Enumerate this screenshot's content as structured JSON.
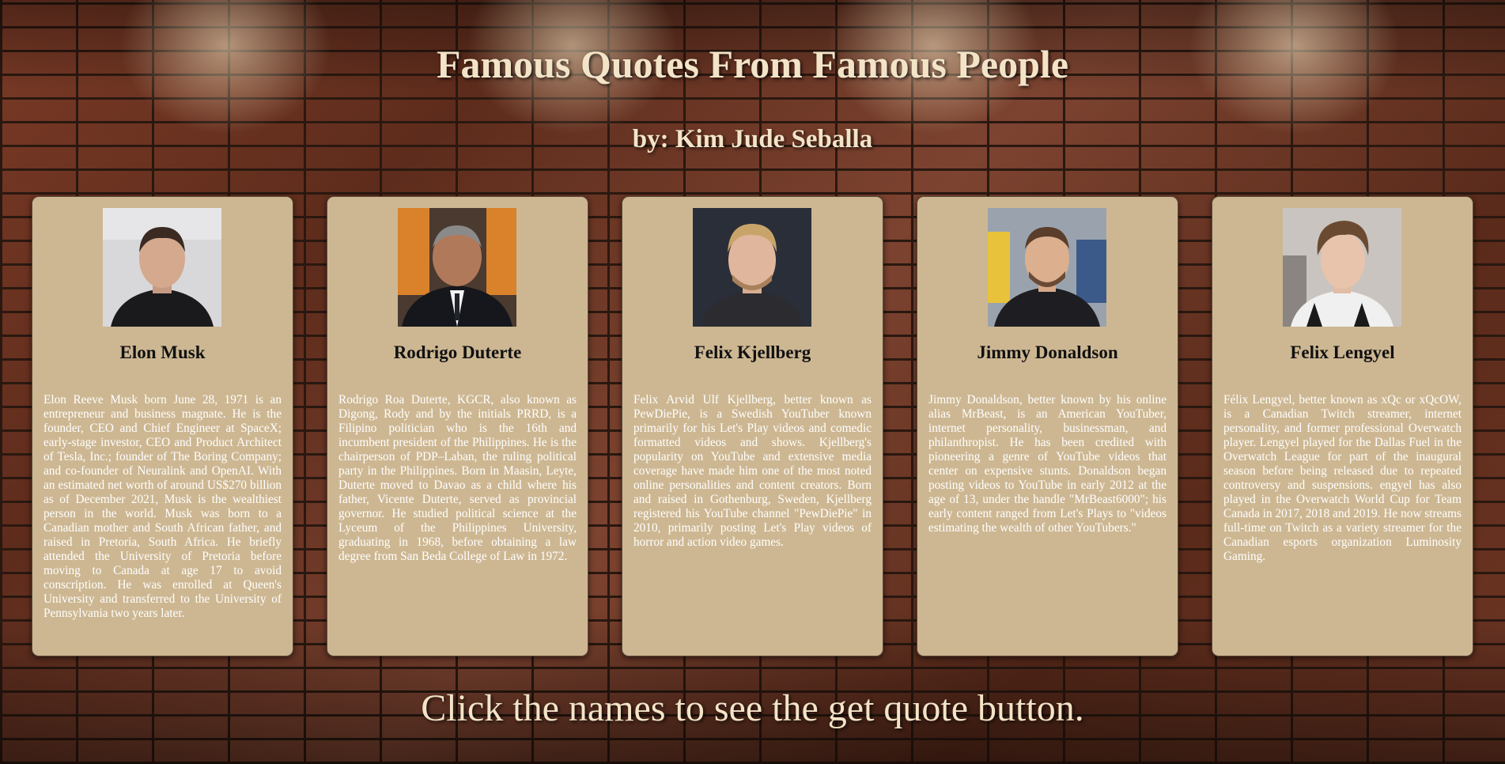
{
  "header": {
    "title": "Famous Quotes From Famous People",
    "subtitle": "by: Kim Jude Seballa"
  },
  "cards": [
    {
      "name": "Elon Musk",
      "bio": "Elon Reeve Musk born June 28, 1971 is an entrepreneur and business magnate. He is the founder, CEO and Chief Engineer at SpaceX; early-stage investor, CEO and Product Architect of Tesla, Inc.; founder of The Boring Company; and co-founder of Neuralink and OpenAI. With an estimated net worth of around US$270 billion as of December 2021, Musk is the wealthiest person in the world. Musk was born to a Canadian mother and South African father, and raised in Pretoria, South Africa. He briefly attended the University of Pretoria before moving to Canada at age 17 to avoid conscription. He was enrolled at Queen's University and transferred to the University of Pennsylvania two years later."
    },
    {
      "name": "Rodrigo Duterte",
      "bio": "Rodrigo Roa Duterte, KGCR, also known as Digong, Rody and by the initials PRRD, is a Filipino politician who is the 16th and incumbent president of the Philippines. He is the chairperson of PDP–Laban, the ruling political party in the Philippines. Born in Maasin, Leyte, Duterte moved to Davao as a child where his father, Vicente Duterte, served as provincial governor. He studied political science at the Lyceum of the Philippines University, graduating in 1968, before obtaining a law degree from San Beda College of Law in 1972."
    },
    {
      "name": "Felix Kjellberg",
      "bio": "Felix Arvid Ulf Kjellberg, better known as PewDiePie, is a Swedish YouTuber known primarily for his Let's Play videos and comedic formatted videos and shows. Kjellberg's popularity on YouTube and extensive media coverage have made him one of the most noted online personalities and content creators. Born and raised in Gothenburg, Sweden, Kjellberg registered his YouTube channel \"PewDiePie\" in 2010, primarily posting Let's Play videos of horror and action video games."
    },
    {
      "name": "Jimmy Donaldson",
      "bio": "Jimmy Donaldson, better known by his online alias MrBeast, is an American YouTuber, internet personality, businessman, and philanthropist. He has been credited with pioneering a genre of YouTube videos that center on expensive stunts. Donaldson began posting videos to YouTube in early 2012 at the age of 13, under the handle \"MrBeast6000\"; his early content ranged from Let's Plays to \"videos estimating the wealth of other YouTubers.\""
    },
    {
      "name": "Felix Lengyel",
      "bio": "Félix Lengyel, better known as xQc or xQcOW, is a Canadian Twitch streamer, internet personality, and former professional Overwatch player. Lengyel played for the Dallas Fuel in the Overwatch League for part of the inaugural season before being released due to repeated controversy and suspensions. engyel has also played in the Overwatch World Cup for Team Canada in 2017, 2018 and 2019. He now streams full-time on Twitch as a variety streamer for the Canadian esports organization Luminosity Gaming."
    }
  ],
  "footer": {
    "instruction": "Click the names to see the get quote button."
  }
}
